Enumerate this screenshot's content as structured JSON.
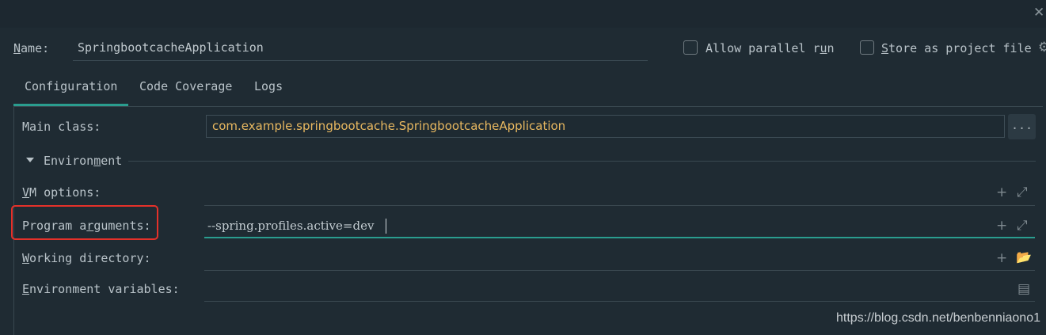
{
  "window": {
    "close_glyph": "✕"
  },
  "name_row": {
    "label_prefix": "",
    "label_mnemonic": "N",
    "label_suffix": "ame:",
    "value": "SpringbootcacheApplication"
  },
  "options": {
    "allow_parallel": {
      "prefix": "Allow parallel r",
      "mnemonic": "u",
      "suffix": "n",
      "checked": false
    },
    "store_project": {
      "prefix": "",
      "mnemonic": "S",
      "suffix": "tore as project file",
      "checked": false
    },
    "gear_glyph": "⚙"
  },
  "tabs": [
    {
      "label": "Configuration",
      "active": true
    },
    {
      "label": "Code Coverage",
      "active": false
    },
    {
      "label": "Logs",
      "active": false
    }
  ],
  "main_class": {
    "label": "Main class:",
    "value": "com.example.springbootcache.SpringbootcacheApplication",
    "browse_label": "..."
  },
  "environment": {
    "prefix": "Environ",
    "mnemonic": "m",
    "suffix": "ent"
  },
  "vm_options": {
    "prefix": "",
    "mnemonic": "V",
    "suffix": "M options:",
    "value": ""
  },
  "program_arguments": {
    "prefix": "Program a",
    "mnemonic": "r",
    "suffix": "guments:",
    "value": "--spring.profiles.active=dev"
  },
  "working_directory": {
    "prefix": "",
    "mnemonic": "W",
    "suffix": "orking directory:",
    "value": ""
  },
  "environment_variables": {
    "prefix": "",
    "mnemonic": "E",
    "suffix": "nvironment variables:",
    "value": ""
  },
  "icons": {
    "add": "+",
    "expand": "⤢",
    "folder": "📂",
    "doc": "▤"
  },
  "watermark": "https://blog.csdn.net/benbenniaono1"
}
